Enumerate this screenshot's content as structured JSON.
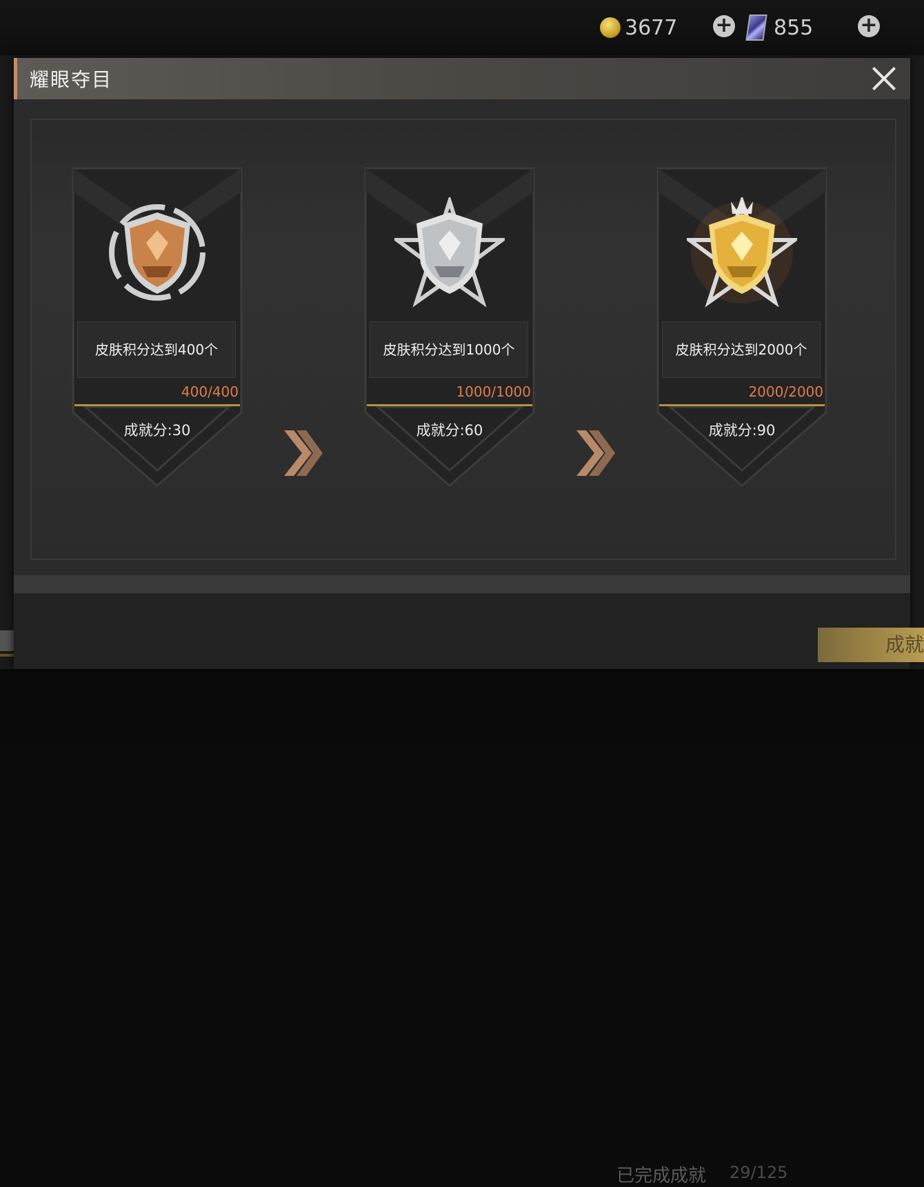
{
  "currency": {
    "coins": "3677",
    "cards": "855"
  },
  "modal": {
    "title": "耀眼夺目",
    "achievements": [
      {
        "task": "皮肤积分达到400个",
        "progress": "400/400",
        "score": "成就分:30",
        "tier": "bronze"
      },
      {
        "task": "皮肤积分达到1000个",
        "progress": "1000/1000",
        "score": "成就分:60",
        "tier": "silver"
      },
      {
        "task": "皮肤积分达到2000个",
        "progress": "2000/2000",
        "score": "成就分:90",
        "tier": "gold"
      }
    ]
  },
  "footer": {
    "completed_label": "已完成成就",
    "completed_count": "29/125",
    "action_label": "成就"
  },
  "icons": {
    "coin": "coin-icon",
    "card": "card-icon",
    "add": "plus-icon",
    "close": "close-icon",
    "arrow": "double-chevron-right-icon",
    "medal": "shield-medal-icon"
  },
  "colors": {
    "bronze": "#c9824a",
    "silver": "#bfc2c5",
    "gold": "#e4b23c",
    "progress_text": "#e07b4c",
    "progress_bar": "#b8923c",
    "header_accent": "#c98d60"
  }
}
